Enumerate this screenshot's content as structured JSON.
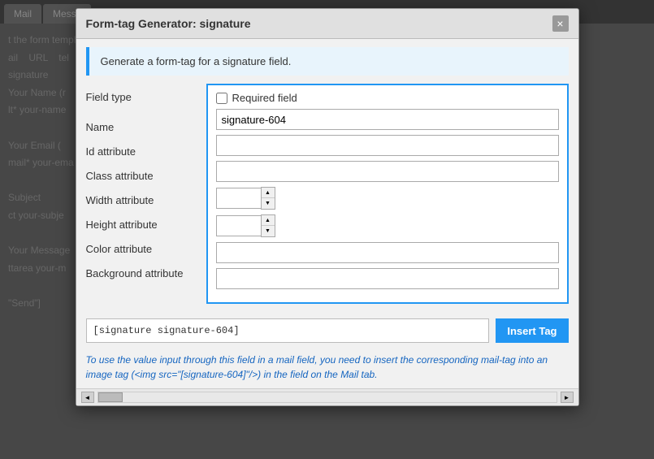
{
  "background": {
    "tabs": [
      {
        "label": "Mail"
      },
      {
        "label": "Messa"
      }
    ],
    "content_lines": [
      "t the form templa",
      "ail   URL   tel",
      "signature",
      "Your Name (r",
      "lt* your-name",
      "",
      "Your Email (",
      "ail* your-ema",
      "",
      "Subject",
      "ct your-subje",
      "",
      "Your Message",
      "ttarea your-m",
      "",
      "\"Send\"]"
    ]
  },
  "modal": {
    "title": "Form-tag Generator: signature",
    "close_label": "×",
    "info_banner": "Generate a form-tag for a signature field.",
    "fields": {
      "field_type_label": "Field type",
      "required_field_label": "Required field",
      "name_label": "Name",
      "name_value": "signature-604",
      "id_label": "Id attribute",
      "id_value": "",
      "class_label": "Class attribute",
      "class_value": "",
      "width_label": "Width attribute",
      "width_value": "",
      "height_label": "Height attribute",
      "height_value": "",
      "color_label": "Color attribute",
      "color_value": "",
      "background_label": "Background attribute",
      "background_value": ""
    },
    "output": {
      "value": "[signature signature-604]",
      "insert_button_label": "Insert Tag"
    },
    "help_text": "To use the value input through this field in a mail field, you need to insert the corresponding mail-tag into an image tag (<img src=\"[signature-604]\"/>) in the field on the Mail tab."
  }
}
